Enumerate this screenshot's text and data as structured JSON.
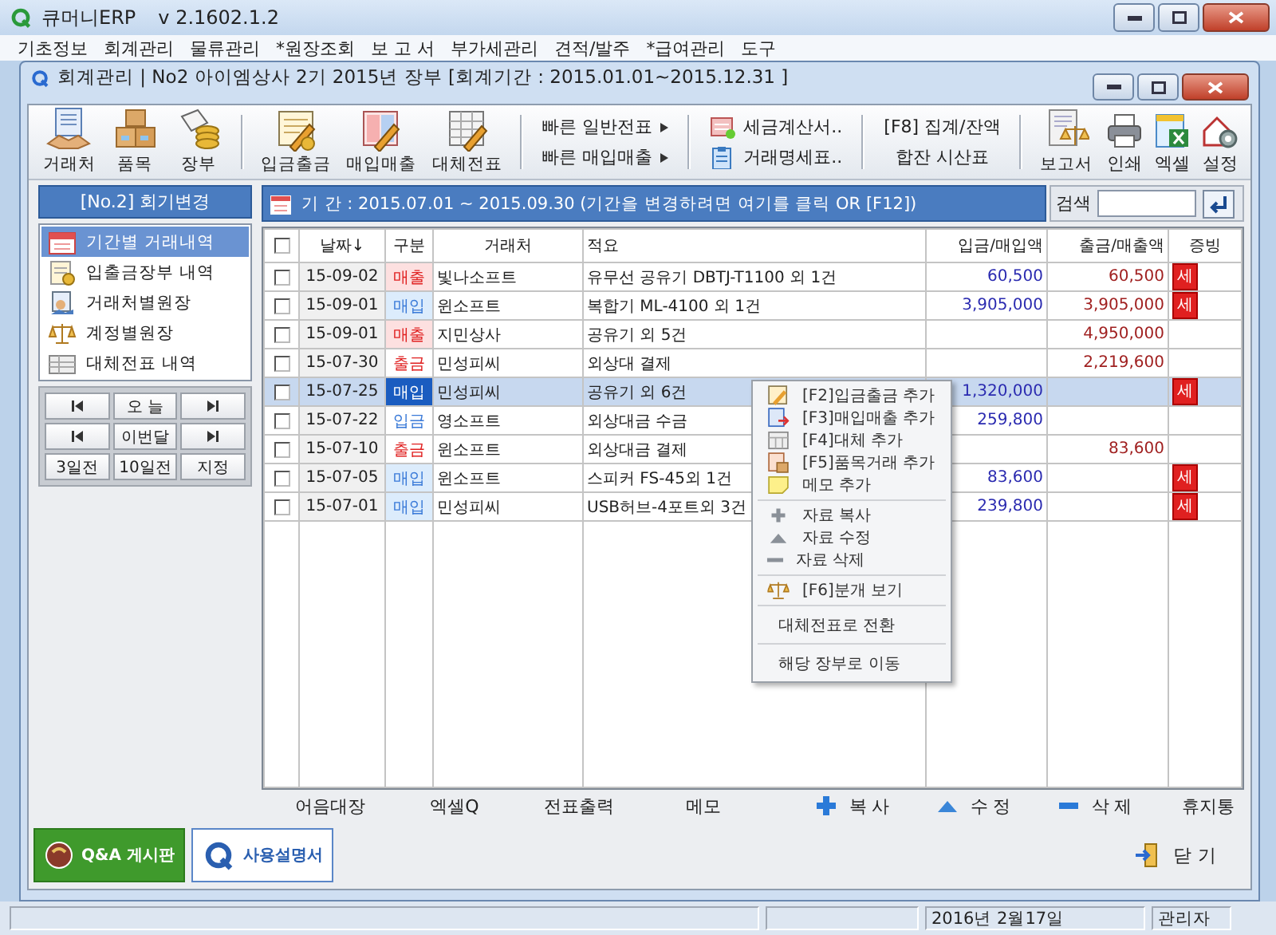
{
  "window": {
    "title": "큐머니ERP",
    "version": "v 2.1602.1.2"
  },
  "menu": [
    "기초정보",
    "회계관리",
    "물류관리",
    "*원장조회",
    "보 고 서",
    "부가세관리",
    "견적/발주",
    "*급여관리",
    "도구"
  ],
  "document": {
    "title": "회계관리 | No2 아이엠상사 2기 2015년 장부 [회계기간 : 2015.01.01~2015.12.31 ]"
  },
  "toolbar": [
    {
      "kind": "large",
      "label": "거래처"
    },
    {
      "kind": "large",
      "label": "품목"
    },
    {
      "kind": "large",
      "label": "장부"
    },
    {
      "kind": "separator"
    },
    {
      "kind": "large",
      "label": "입금출금"
    },
    {
      "kind": "large",
      "label": "매입매출"
    },
    {
      "kind": "large",
      "label": "대체전표"
    },
    {
      "kind": "separator"
    },
    {
      "kind": "stack",
      "items": [
        {
          "kind": "dropdown",
          "label": "빠른 일반전표"
        },
        {
          "kind": "dropdown",
          "label": "빠른 매입매출"
        }
      ]
    },
    {
      "kind": "separator"
    },
    {
      "kind": "stack",
      "items": [
        {
          "kind": "icon",
          "label": "세금계산서.."
        },
        {
          "kind": "icon",
          "label": "거래명세표.."
        }
      ]
    },
    {
      "kind": "separator"
    },
    {
      "kind": "stack",
      "items": [
        {
          "kind": "plain",
          "label": "[F8] 집계/잔액"
        },
        {
          "kind": "plain",
          "label": "합잔 시산표"
        }
      ]
    },
    {
      "kind": "separator"
    },
    {
      "kind": "large",
      "label": "보고서"
    },
    {
      "kind": "small",
      "label": "인쇄"
    },
    {
      "kind": "small",
      "label": "엑셀"
    },
    {
      "kind": "small",
      "label": "설정"
    }
  ],
  "sidebar": {
    "header": "[No.2] 회기변경",
    "items": [
      {
        "label": "기간별 거래내역",
        "selected": true
      },
      {
        "label": "입출금장부 내역",
        "selected": false
      },
      {
        "label": "거래처별원장",
        "selected": false
      },
      {
        "label": "계정별원장",
        "selected": false
      },
      {
        "label": "대체전표 내역",
        "selected": false
      }
    ],
    "nav": [
      {
        "kind": "stepper",
        "labels": [
          "오 늘"
        ]
      },
      {
        "kind": "stepper",
        "labels": [
          "이번달"
        ]
      },
      {
        "kind": "buttons",
        "labels": [
          "3일전",
          "10일전",
          "지정"
        ]
      }
    ]
  },
  "period": {
    "text": "기 간 : 2015.07.01 ~ 2015.09.30  (기간을 변경하려면 여기를 클릭 OR [F12])"
  },
  "search": {
    "label": "검색"
  },
  "table": {
    "header_checkbox": {
      "checked": false
    },
    "columns": [
      "날짜↓",
      "구분",
      "거래처",
      "적요",
      "입금/매입액",
      "출금/매출액",
      "증빙"
    ],
    "rows": [
      {
        "checked": false,
        "selected": false,
        "date": "15-09-02",
        "type": {
          "label": "매출",
          "kind": "sale"
        },
        "partner": "빛나소프트",
        "memo": "유무선 공유기 DBTJ-T1100 외 1건",
        "deposit": "60,500",
        "withdrawal": "60,500",
        "receipt": "세"
      },
      {
        "checked": false,
        "selected": false,
        "date": "15-09-01",
        "type": {
          "label": "매입",
          "kind": "purchase"
        },
        "partner": "윈소프트",
        "memo": "복합기 ML-4100 외 1건",
        "deposit": "3,905,000",
        "withdrawal": "3,905,000",
        "receipt": "세"
      },
      {
        "checked": false,
        "selected": false,
        "date": "15-09-01",
        "type": {
          "label": "매출",
          "kind": "sale"
        },
        "partner": "지민상사",
        "memo": "공유기 외 5건",
        "withdrawal": "4,950,000"
      },
      {
        "checked": false,
        "selected": false,
        "date": "15-07-30",
        "type": {
          "label": "출금",
          "kind": "out"
        },
        "partner": "민성피씨",
        "memo": "외상대 결제",
        "withdrawal": "2,219,600"
      },
      {
        "checked": false,
        "selected": true,
        "date": "15-07-25",
        "type": {
          "label": "매입",
          "kind": "purchase"
        },
        "partner": "민성피씨",
        "memo": "공유기 외 6건",
        "deposit": "1,320,000",
        "receipt": "세"
      },
      {
        "checked": false,
        "selected": false,
        "date": "15-07-22",
        "type": {
          "label": "입금",
          "kind": "in"
        },
        "partner": "영소프트",
        "memo": "외상대금 수금",
        "deposit": "259,800"
      },
      {
        "checked": false,
        "selected": false,
        "date": "15-07-10",
        "type": {
          "label": "출금",
          "kind": "out"
        },
        "partner": "윈소프트",
        "memo": "외상대금 결제",
        "withdrawal": "83,600"
      },
      {
        "checked": false,
        "selected": false,
        "date": "15-07-05",
        "type": {
          "label": "매입",
          "kind": "purchase"
        },
        "partner": "윈소프트",
        "memo": "스피커 FS-45외 1건",
        "deposit": "83,600",
        "receipt": "세"
      },
      {
        "checked": false,
        "selected": false,
        "date": "15-07-01",
        "type": {
          "label": "매입",
          "kind": "purchase"
        },
        "partner": "민성피씨",
        "memo": "USB허브-4포트외 3건",
        "deposit": "239,800",
        "receipt": "세"
      }
    ]
  },
  "context_menu": [
    {
      "kind": "item",
      "label": "[F2]입금출금 추가"
    },
    {
      "kind": "item",
      "label": "[F3]매입매출 추가"
    },
    {
      "kind": "item",
      "label": "[F4]대체 추가"
    },
    {
      "kind": "item",
      "label": "[F5]품목거래 추가"
    },
    {
      "kind": "item",
      "label": "메모 추가"
    },
    {
      "kind": "separator"
    },
    {
      "kind": "item",
      "label": "자료 복사"
    },
    {
      "kind": "item",
      "label": "자료 수정"
    },
    {
      "kind": "item",
      "label": "자료 삭제"
    },
    {
      "kind": "separator"
    },
    {
      "kind": "item",
      "label": "[F6]분개 보기"
    },
    {
      "kind": "separator"
    },
    {
      "kind": "text",
      "label": "대체전표로 전환"
    },
    {
      "kind": "separator"
    },
    {
      "kind": "text",
      "label": "해당 장부로 이동"
    }
  ],
  "actions": [
    {
      "kind": "text",
      "label": "어음대장"
    },
    {
      "kind": "text",
      "label": "엑셀Q"
    },
    {
      "kind": "text",
      "label": "전표출력"
    },
    {
      "kind": "text",
      "label": "메모"
    },
    {
      "kind": "icon",
      "label": "복 사"
    },
    {
      "kind": "icon",
      "label": "수 정"
    },
    {
      "kind": "icon",
      "label": "삭 제"
    },
    {
      "kind": "text",
      "label": "휴지통"
    }
  ],
  "footer": {
    "buttons": [
      {
        "kind": "qa",
        "label": "Q&A 게시판"
      },
      {
        "kind": "manual",
        "label": "사용설명서"
      }
    ],
    "close": "닫 기"
  },
  "status_bar": [
    "2016년 2월17일",
    "관리자"
  ]
}
